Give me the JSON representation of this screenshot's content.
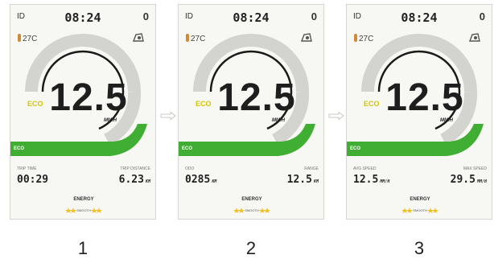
{
  "screens": [
    {
      "id_label": "ID",
      "clock": "08:24",
      "top_right": "0",
      "temperature": "27C",
      "assist_level": "ECO",
      "speed": "12.5",
      "speed_unit": "MM/H",
      "mode_label": "ECO",
      "stats": [
        {
          "label": "TRIP TIME",
          "value": "00:29",
          "unit": ""
        },
        {
          "label": "TRIP DISTANCE",
          "value": "6.23",
          "unit": "KM"
        }
      ],
      "logo": "ENERGY",
      "logo_sub": "SMOOTH"
    },
    {
      "id_label": "ID",
      "clock": "08:24",
      "top_right": "0",
      "temperature": "27C",
      "assist_level": "ECO",
      "speed": "12.5",
      "speed_unit": "MM/H",
      "mode_label": "ECO",
      "stats": [
        {
          "label": "ODO",
          "value": "0285",
          "unit": "KM"
        },
        {
          "label": "RANGE",
          "value": "12.5",
          "unit": "KM"
        }
      ],
      "logo": "ENERGY",
      "logo_sub": "SMOOTH"
    },
    {
      "id_label": "ID",
      "clock": "08:24",
      "top_right": "0",
      "temperature": "27C",
      "assist_level": "ECO",
      "speed": "12.5",
      "speed_unit": "MM/H",
      "mode_label": "ECO",
      "stats": [
        {
          "label": "AVG SPEED",
          "value": "12.5",
          "unit": "MM/H"
        },
        {
          "label": "MAX SPEED",
          "value": "29.5",
          "unit": "MM/H"
        }
      ],
      "logo": "ENERGY",
      "logo_sub": "SMOOTH"
    }
  ],
  "captions": [
    "1",
    "2",
    "3"
  ],
  "colors": {
    "gauge_track": "#d3d3cf",
    "progress_green": "#3fae32",
    "arc_black": "#1a1a1a",
    "assist_yellow": "#d6c400",
    "accent_orange": "#e08a2a",
    "star_yellow": "#f0c020"
  },
  "icons": [
    "thermometer-icon",
    "light-icon",
    "arrow-right-icon",
    "star-icon"
  ]
}
